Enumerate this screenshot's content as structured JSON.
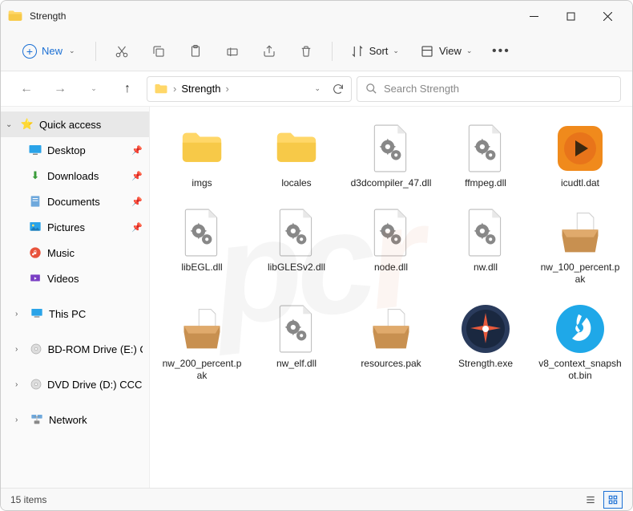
{
  "window": {
    "title": "Strength"
  },
  "toolbar": {
    "new_label": "New",
    "sort_label": "Sort",
    "view_label": "View"
  },
  "breadcrumb": {
    "item1": "Strength"
  },
  "search": {
    "placeholder": "Search Strength"
  },
  "sidebar": {
    "quick_access": "Quick access",
    "desktop": "Desktop",
    "downloads": "Downloads",
    "documents": "Documents",
    "pictures": "Pictures",
    "music": "Music",
    "videos": "Videos",
    "this_pc": "This PC",
    "bdrom": "BD-ROM Drive (E:) C",
    "dvd": "DVD Drive (D:) CCCC",
    "network": "Network"
  },
  "files": [
    {
      "name": "imgs",
      "type": "folder"
    },
    {
      "name": "locales",
      "type": "folder"
    },
    {
      "name": "d3dcompiler_47.dll",
      "type": "dll"
    },
    {
      "name": "ffmpeg.dll",
      "type": "dll"
    },
    {
      "name": "icudtl.dat",
      "type": "dat"
    },
    {
      "name": "libEGL.dll",
      "type": "dll"
    },
    {
      "name": "libGLESv2.dll",
      "type": "dll"
    },
    {
      "name": "node.dll",
      "type": "dll"
    },
    {
      "name": "nw.dll",
      "type": "dll"
    },
    {
      "name": "nw_100_percent.pak",
      "type": "pak"
    },
    {
      "name": "nw_200_percent.pak",
      "type": "pak"
    },
    {
      "name": "nw_elf.dll",
      "type": "dll"
    },
    {
      "name": "resources.pak",
      "type": "pak"
    },
    {
      "name": "Strength.exe",
      "type": "exe"
    },
    {
      "name": "v8_context_snapshot.bin",
      "type": "bin"
    }
  ],
  "status": {
    "count": "15 items"
  }
}
